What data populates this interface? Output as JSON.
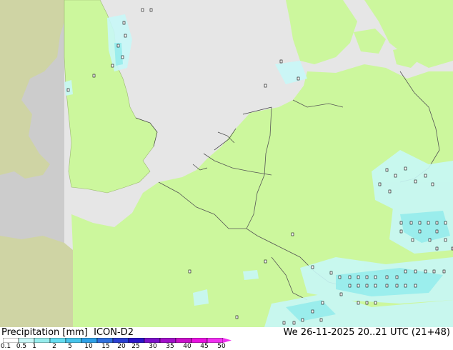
{
  "footer": {
    "product_label": "Precipitation [mm]",
    "model_label": "ICON-D2",
    "valid_time": "We 26-11-2025 20..21 UTC (21+48)"
  },
  "legend": {
    "ticks": [
      "0.1",
      "0.5",
      "1",
      "2",
      "5",
      "10",
      "15",
      "20",
      "25",
      "30",
      "35",
      "40",
      "45",
      "50"
    ],
    "colors": [
      "#ffffff",
      "#c8f7f7",
      "#96ecec",
      "#64dcf0",
      "#46c3ea",
      "#2ea0e6",
      "#2f6fdc",
      "#2a3fd0",
      "#2a15c8",
      "#7a10c8",
      "#a010c8",
      "#c810c8",
      "#e810e0",
      "#f030f0"
    ]
  },
  "map": {
    "colors": {
      "sea": "#e6e6e6",
      "land_in_domain": "#ccf79d",
      "land_outside_domain": "#cfd4a4",
      "outside_domain": "#cccccc",
      "border": "#555555",
      "rain_light": "#c8f7f7",
      "rain_medium": "#96ecec"
    }
  }
}
